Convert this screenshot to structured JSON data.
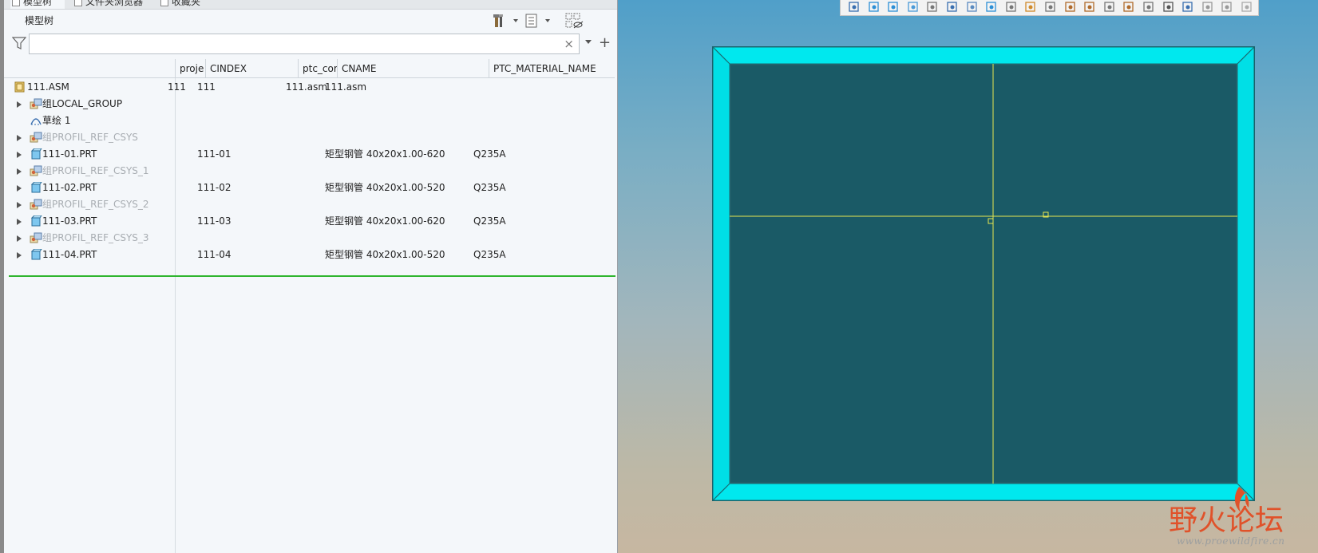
{
  "tabs": [
    {
      "label": "模型树"
    },
    {
      "label": "文件夹浏览器"
    },
    {
      "label": "收藏夹"
    }
  ],
  "tree_title": "模型树",
  "search": {
    "value": "",
    "placeholder": "",
    "clear_glyph": "×"
  },
  "columns": [
    "proje",
    "CINDEX",
    "ptc_cor",
    "CNAME",
    "PTC_MATERIAL_NAME"
  ],
  "rows": [
    {
      "name": "111.ASM",
      "icon": "assembly-icon",
      "expandable": false,
      "dim": false,
      "proj": "111",
      "cindex": "111",
      "ptc": "111.asm",
      "cname": "111.asm",
      "material": ""
    },
    {
      "name": "组LOCAL_GROUP",
      "icon": "group-icon",
      "expandable": true,
      "dim": false,
      "proj": "",
      "cindex": "",
      "ptc": "",
      "cname": "",
      "material": ""
    },
    {
      "name": "草绘 1",
      "icon": "sketch-icon",
      "expandable": false,
      "dim": false,
      "proj": "",
      "cindex": "",
      "ptc": "",
      "cname": "",
      "material": ""
    },
    {
      "name": "组PROFIL_REF_CSYS",
      "icon": "group-icon",
      "expandable": true,
      "dim": true,
      "proj": "",
      "cindex": "",
      "ptc": "",
      "cname": "",
      "material": ""
    },
    {
      "name": "111-01.PRT",
      "icon": "part-icon",
      "expandable": true,
      "dim": false,
      "proj": "",
      "cindex": "111-01",
      "ptc": "",
      "cname": "矩型钢管 40x20x1.00-620",
      "material": "Q235A"
    },
    {
      "name": "组PROFIL_REF_CSYS_1",
      "icon": "group-icon",
      "expandable": true,
      "dim": true,
      "proj": "",
      "cindex": "",
      "ptc": "",
      "cname": "",
      "material": ""
    },
    {
      "name": "111-02.PRT",
      "icon": "part-icon",
      "expandable": true,
      "dim": false,
      "proj": "",
      "cindex": "111-02",
      "ptc": "",
      "cname": "矩型钢管 40x20x1.00-520",
      "material": "Q235A"
    },
    {
      "name": "组PROFIL_REF_CSYS_2",
      "icon": "group-icon",
      "expandable": true,
      "dim": true,
      "proj": "",
      "cindex": "",
      "ptc": "",
      "cname": "",
      "material": ""
    },
    {
      "name": "111-03.PRT",
      "icon": "part-icon",
      "expandable": true,
      "dim": false,
      "proj": "",
      "cindex": "111-03",
      "ptc": "",
      "cname": "矩型钢管 40x20x1.00-620",
      "material": "Q235A"
    },
    {
      "name": "组PROFIL_REF_CSYS_3",
      "icon": "group-icon",
      "expandable": true,
      "dim": true,
      "proj": "",
      "cindex": "",
      "ptc": "",
      "cname": "",
      "material": ""
    },
    {
      "name": "111-04.PRT",
      "icon": "part-icon",
      "expandable": true,
      "dim": false,
      "proj": "",
      "cindex": "111-04",
      "ptc": "",
      "cname": "矩型钢管 40x20x1.00-520",
      "material": "Q235A"
    }
  ],
  "watermark": {
    "text": "野火论坛",
    "url": "www.proewildfire.cn"
  },
  "colors": {
    "frame": "#00e8ee",
    "sketch_line": "#e6e650",
    "insertion_line": "#2fb52f",
    "watermark_red": "#e0522a"
  }
}
